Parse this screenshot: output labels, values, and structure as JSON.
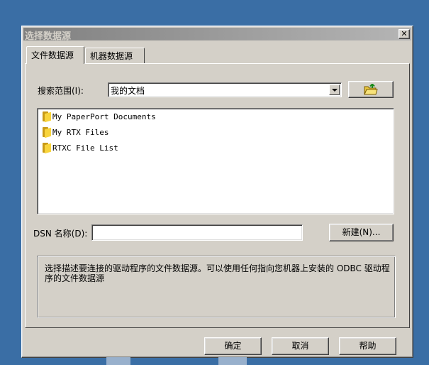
{
  "dialog": {
    "title": "选择数据源",
    "close_glyph": "✕"
  },
  "tabs": [
    {
      "label": "文件数据源",
      "active": true
    },
    {
      "label": "机器数据源",
      "active": false
    }
  ],
  "lookin": {
    "label": "搜索范围(I):",
    "value": "我的文档",
    "up_icon": "up-folder-icon"
  },
  "files": [
    {
      "name": "My PaperPort Documents",
      "icon": "folder-icon"
    },
    {
      "name": "My RTX Files",
      "icon": "folder-icon"
    },
    {
      "name": "RTXC File List",
      "icon": "folder-icon"
    }
  ],
  "dsn": {
    "label": "DSN 名称(D):",
    "value": "",
    "new_button": "新建(N)..."
  },
  "description": "选择描述要连接的驱动程序的文件数据源。可以使用任何指向您机器上安装的 ODBC 驱动程序的文件数据源",
  "buttons": {
    "ok": "确定",
    "cancel": "取消",
    "help": "帮助"
  },
  "colors": {
    "desktop": "#3a6ea5",
    "dialog_face": "#d4d0c8",
    "titlebar_inactive": "#808080"
  }
}
